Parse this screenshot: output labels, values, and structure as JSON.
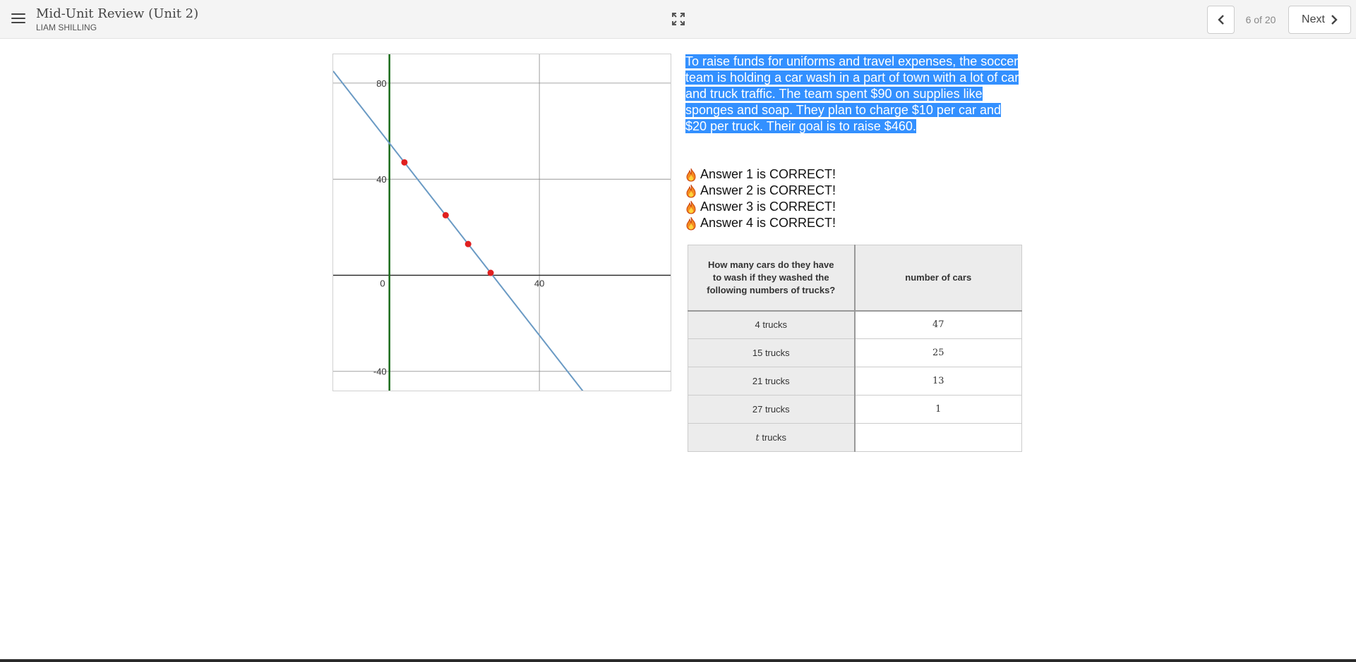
{
  "header": {
    "title": "Mid-Unit Review (Unit 2)",
    "student": "LIAM SHILLING",
    "page_indicator": "6 of 20",
    "next_label": "Next",
    "icons": {
      "menu": "hamburger-menu-icon",
      "expand": "expand-icon",
      "prev": "chevron-left-icon",
      "next": "chevron-right-icon"
    }
  },
  "problem": {
    "text": "To raise funds for uniforms and travel expenses, the soccer team is holding a car wash in a part of town with a lot of car and truck traffic. The team spent $90 on supplies like sponges and soap. They plan to charge $10 per car and $20 per truck. Their goal is to raise $460.",
    "highlight_color": "#3390ff"
  },
  "answers": [
    "Answer 1 is CORRECT!",
    "Answer 2 is CORRECT!",
    "Answer 3 is CORRECT!",
    "Answer 4 is CORRECT!"
  ],
  "answer_icon": "fire-icon",
  "table": {
    "header_question": "How many cars do they have to wash if they washed the following numbers of trucks?",
    "header_value": "number of cars",
    "rows": [
      {
        "label": "4 trucks",
        "value": "47"
      },
      {
        "label": "15 trucks",
        "value": "25"
      },
      {
        "label": "21 trucks",
        "value": "13"
      },
      {
        "label": "27 trucks",
        "value": "1"
      }
    ],
    "var_row": {
      "var": "t",
      "suffix": " trucks",
      "value": ""
    }
  },
  "chart_data": {
    "type": "line",
    "xlim": [
      -15,
      75
    ],
    "ylim": [
      -48,
      92
    ],
    "x_ticks": [
      0,
      40
    ],
    "y_ticks": [
      80,
      40,
      -40
    ],
    "origin_label": "0",
    "grid": true,
    "line": {
      "slope": -2,
      "intercept": 55,
      "color": "#6a9ac4"
    },
    "points": [
      {
        "x": 4,
        "y": 47
      },
      {
        "x": 15,
        "y": 25
      },
      {
        "x": 21,
        "y": 13
      },
      {
        "x": 27,
        "y": 1
      }
    ],
    "point_color": "#e02020",
    "y_axis_color": "#1a6b1a"
  }
}
